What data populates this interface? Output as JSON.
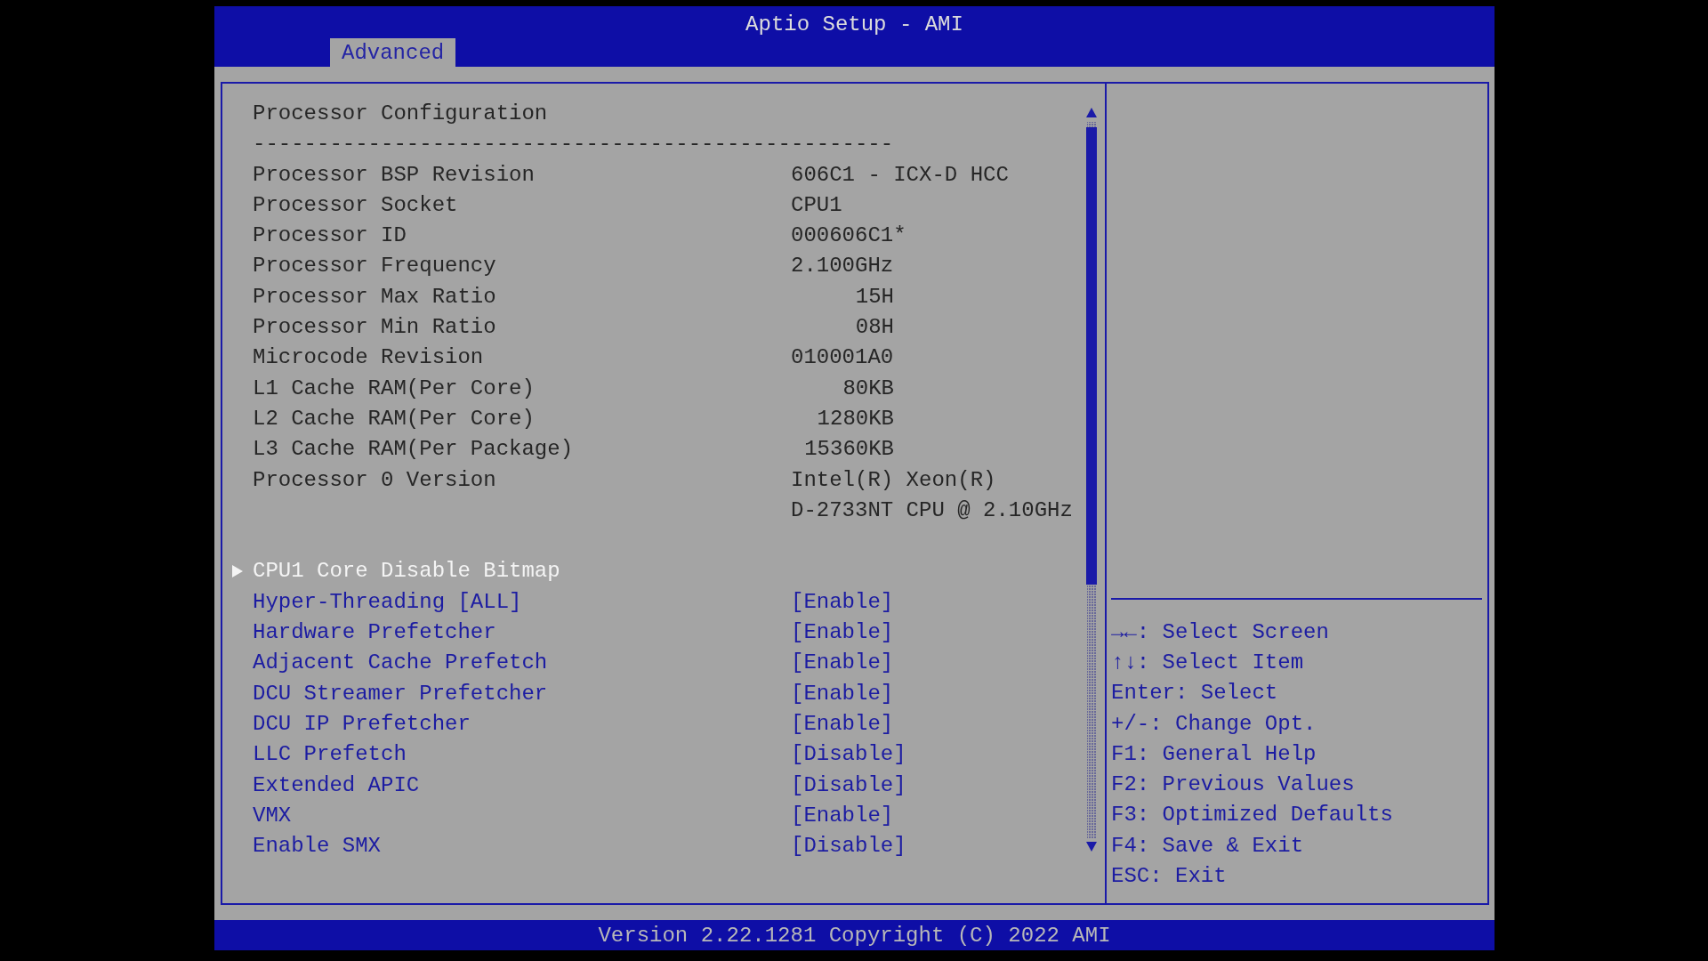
{
  "window": {
    "title": "Aptio Setup - AMI"
  },
  "tabs": [
    {
      "label": "Advanced",
      "selected": true
    }
  ],
  "rows": [
    {
      "kind": "heading",
      "label": "Processor Configuration"
    },
    {
      "kind": "separator",
      "label": "--------------------------------------------------"
    },
    {
      "kind": "info",
      "label": "Processor BSP Revision",
      "value": "606C1 - ICX-D HCC"
    },
    {
      "kind": "info",
      "label": "Processor Socket",
      "value": "CPU1"
    },
    {
      "kind": "info",
      "label": "Processor ID",
      "value": "000606C1*"
    },
    {
      "kind": "info",
      "label": "Processor Frequency",
      "value": "2.100GHz"
    },
    {
      "kind": "padded",
      "label": "Processor Max Ratio",
      "value": "15H"
    },
    {
      "kind": "padded",
      "label": "Processor Min Ratio",
      "value": "08H"
    },
    {
      "kind": "info",
      "label": "Microcode Revision",
      "value": "010001A0"
    },
    {
      "kind": "padded",
      "label": "L1 Cache RAM(Per Core)",
      "value": "80KB"
    },
    {
      "kind": "padded",
      "label": "L2 Cache RAM(Per Core)",
      "value": "1280KB"
    },
    {
      "kind": "padded",
      "label": "L3 Cache RAM(Per Package)",
      "value": "15360KB"
    },
    {
      "kind": "info",
      "label": "Processor 0 Version",
      "value": "Intel(R) Xeon(R)"
    },
    {
      "kind": "continuation",
      "value": "D-2733NT CPU @ 2.10GHz"
    },
    {
      "kind": "spacer"
    },
    {
      "kind": "submenu",
      "label": "CPU1 Core Disable Bitmap",
      "selected": true
    },
    {
      "kind": "option",
      "label": "Hyper-Threading [ALL]",
      "value": "[Enable]",
      "selected": false
    },
    {
      "kind": "option",
      "label": "Hardware Prefetcher",
      "value": "[Enable]",
      "selected": false
    },
    {
      "kind": "option",
      "label": "Adjacent Cache Prefetch",
      "value": "[Enable]",
      "selected": false
    },
    {
      "kind": "option",
      "label": "DCU Streamer Prefetcher",
      "value": "[Enable]",
      "selected": false
    },
    {
      "kind": "option",
      "label": "DCU IP Prefetcher",
      "value": "[Enable]",
      "selected": false
    },
    {
      "kind": "option",
      "label": "LLC Prefetch",
      "value": "[Disable]",
      "selected": false
    },
    {
      "kind": "option",
      "label": "Extended APIC",
      "value": "[Disable]",
      "selected": false
    },
    {
      "kind": "option",
      "label": "VMX",
      "value": "[Enable]",
      "selected": false
    },
    {
      "kind": "option",
      "label": "Enable SMX",
      "value": "[Disable]",
      "selected": false
    }
  ],
  "help": [
    "→←: Select Screen",
    "↑↓: Select Item",
    "Enter: Select",
    "+/-: Change Opt.",
    "F1: General Help",
    "F2: Previous Values",
    "F3: Optimized Defaults",
    "F4: Save & Exit",
    "ESC: Exit"
  ],
  "status_bar": "Version 2.22.1281 Copyright (C) 2022 AMI"
}
